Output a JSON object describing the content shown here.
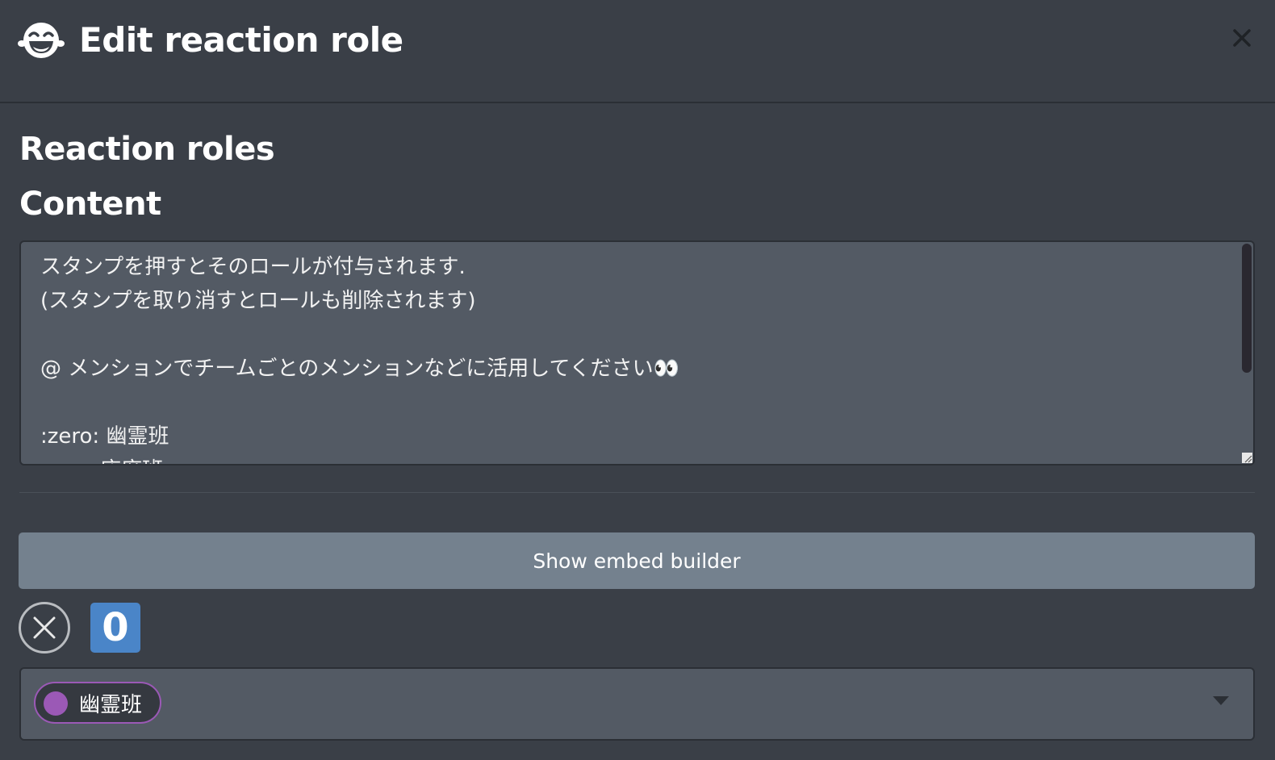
{
  "header": {
    "title": "Edit reaction role",
    "icon": "laughing-face-icon"
  },
  "sections": {
    "reaction_roles_title": "Reaction roles",
    "content_title": "Content"
  },
  "content": {
    "value": "スタンプを押すとそのロールが付与されます.\n(スタンプを取り消すとロールも削除されます)\n\n@ メンションでチームごとのメンションなどに活用してください👀\n\n:zero: 幽霊班\n:one: 座席班"
  },
  "embed": {
    "button_label": "Show embed builder"
  },
  "reaction": {
    "emoji_label": "0",
    "emoji_color": "#4a85c8"
  },
  "role": {
    "selected": "幽霊班",
    "color": "#9b59b6"
  },
  "colors": {
    "background": "#3a3f47",
    "field": "#535a64",
    "button": "#74818e"
  }
}
